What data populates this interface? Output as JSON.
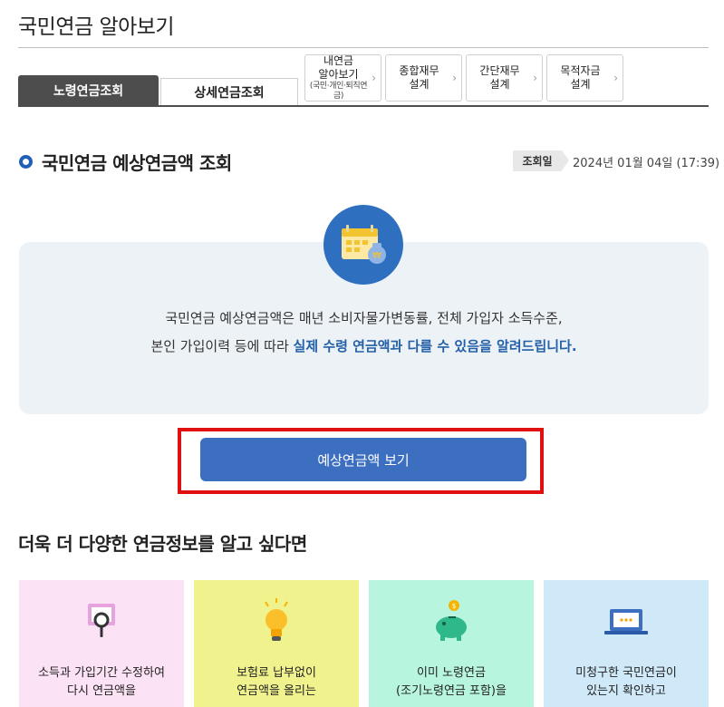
{
  "page": {
    "title": "국민연금 알아보기"
  },
  "tabs": {
    "main": [
      {
        "label": "노령연금조회",
        "active": true
      },
      {
        "label": "상세연금조회",
        "active": false
      }
    ],
    "sub": [
      {
        "line1": "내연금",
        "line2": "알아보기",
        "note": "(국민·개인·퇴직연금)"
      },
      {
        "line1": "종합재무",
        "line2": "설계"
      },
      {
        "line1": "간단재무",
        "line2": "설계"
      },
      {
        "line1": "목적자금",
        "line2": "설계"
      }
    ],
    "chevron": "›"
  },
  "section": {
    "title": "국민연금 예상연금액 조회",
    "date_label": "조회일",
    "date_value": "2024년 01월 04일 (17:39)"
  },
  "info": {
    "icon": "calendar-money-icon",
    "line1": "국민연금 예상연금액은 매년 소비자물가변동률, 전체 가입자 소득수준,",
    "line2_prefix": "본인 가입이력 등에 따라 ",
    "line2_highlight": "실제 수령 연금액과 다를 수 있음을 알려드립니다."
  },
  "primary_button": {
    "label": "예상연금액 보기"
  },
  "more": {
    "title": "더욱 더 다양한 연금정보를 알고 싶다면",
    "cards": [
      {
        "icon": "search-monitor-icon",
        "line1": "소득과 가입기간 수정하여",
        "line2": "다시 연금액을"
      },
      {
        "icon": "lightbulb-icon",
        "line1": "보험료 납부없이",
        "line2": "연금액을 올리는"
      },
      {
        "icon": "piggy-bank-icon",
        "line1": "이미 노령연금",
        "line2": "(조기노령연금 포함)을"
      },
      {
        "icon": "laptop-icon",
        "line1": "미청구한 국민연금이",
        "line2": "있는지 확인하고"
      }
    ]
  },
  "colors": {
    "accent": "#3d6fc1",
    "highlight": "#2360a8",
    "focus_outline": "#e01010",
    "card_pink": "#fbe2f5",
    "card_yellow": "#f0f28e",
    "card_mint": "#b7f5df",
    "card_blue": "#cfe9f8"
  }
}
